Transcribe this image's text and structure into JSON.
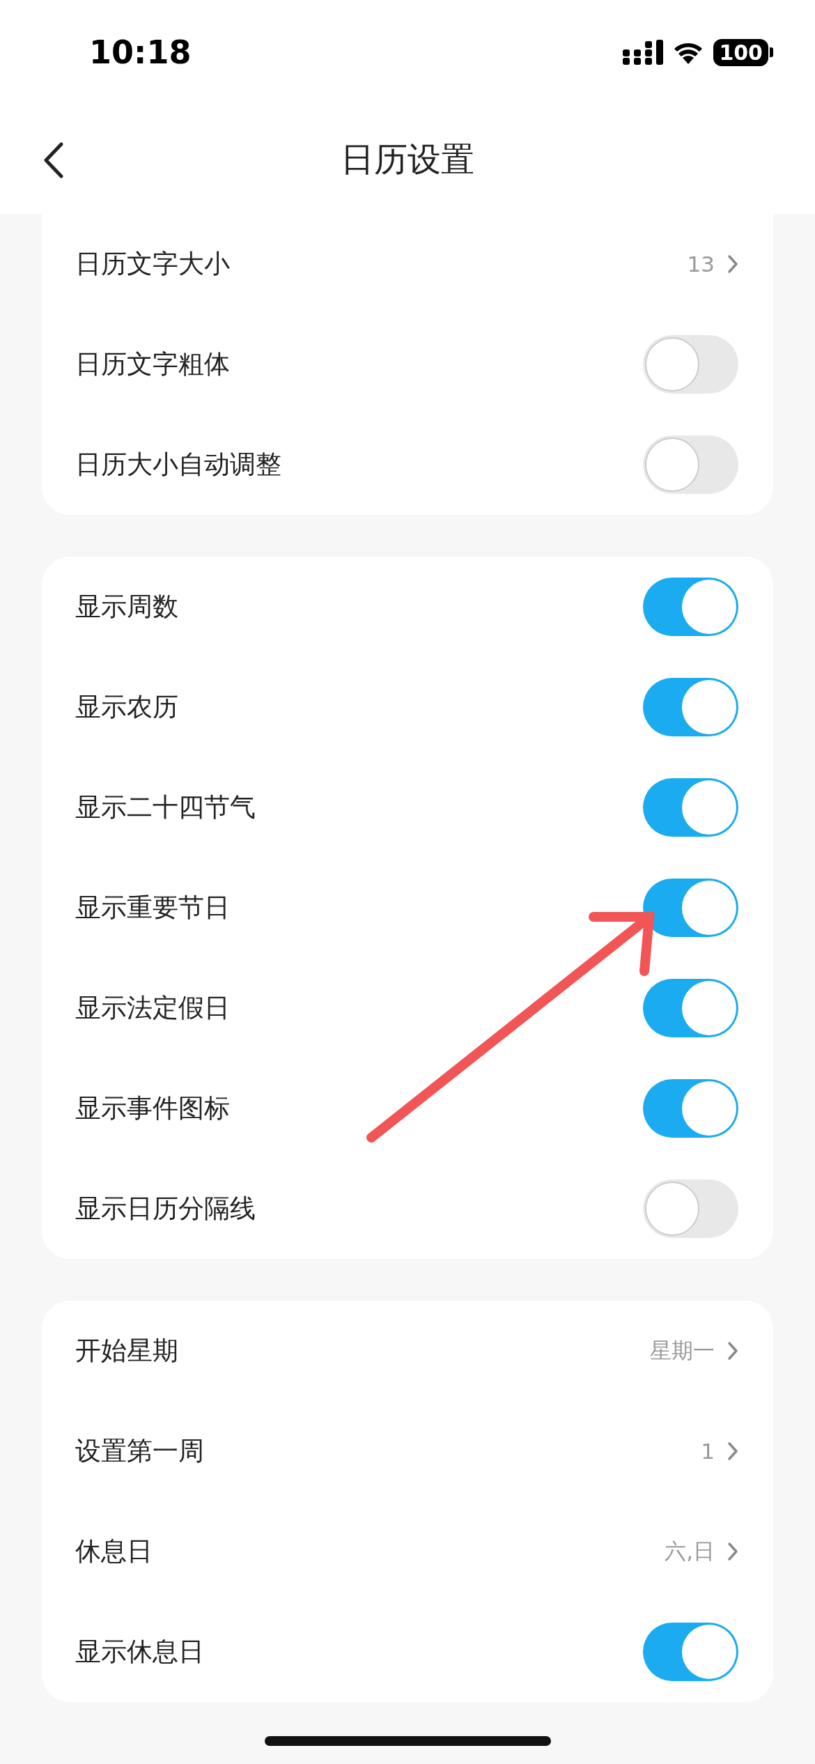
{
  "status_bar": {
    "time": "10:18",
    "battery": "100"
  },
  "nav": {
    "title": "日历设置"
  },
  "groups": [
    {
      "rows": [
        {
          "kind": "value",
          "label": "日历文字大小",
          "value": "13"
        },
        {
          "kind": "toggle",
          "label": "日历文字粗体",
          "on": false
        },
        {
          "kind": "toggle",
          "label": "日历大小自动调整",
          "on": false
        }
      ]
    },
    {
      "rows": [
        {
          "kind": "toggle",
          "label": "显示周数",
          "on": true
        },
        {
          "kind": "toggle",
          "label": "显示农历",
          "on": true
        },
        {
          "kind": "toggle",
          "label": "显示二十四节气",
          "on": true
        },
        {
          "kind": "toggle",
          "label": "显示重要节日",
          "on": true
        },
        {
          "kind": "toggle",
          "label": "显示法定假日",
          "on": true
        },
        {
          "kind": "toggle",
          "label": "显示事件图标",
          "on": true
        },
        {
          "kind": "toggle",
          "label": "显示日历分隔线",
          "on": false
        }
      ]
    },
    {
      "rows": [
        {
          "kind": "value",
          "label": "开始星期",
          "value": "星期一"
        },
        {
          "kind": "value",
          "label": "设置第一周",
          "value": "1"
        },
        {
          "kind": "value",
          "label": "休息日",
          "value": "六,日"
        },
        {
          "kind": "toggle",
          "label": "显示休息日",
          "on": true
        }
      ]
    }
  ]
}
